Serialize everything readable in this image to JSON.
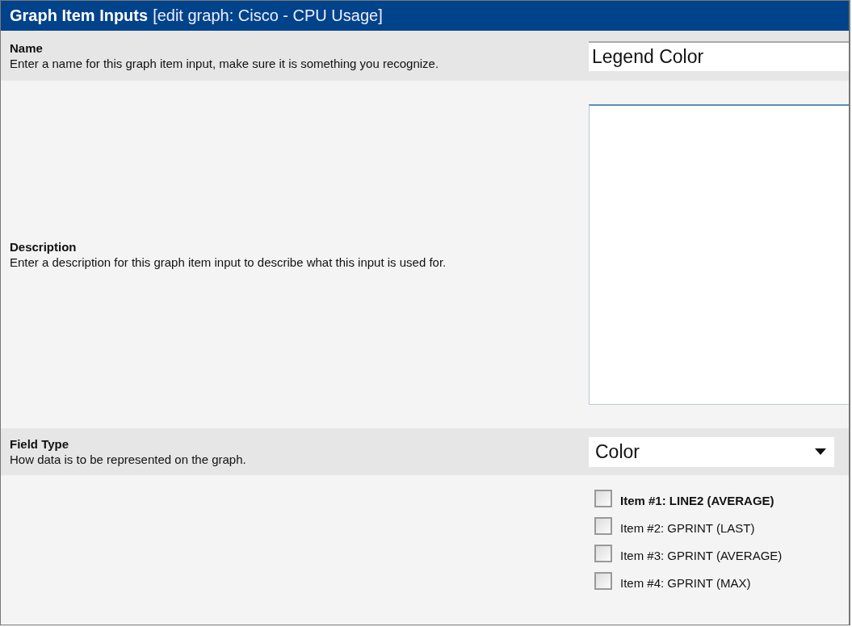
{
  "header": {
    "title": "Graph Item Inputs",
    "subtitle": "[edit graph: Cisco - CPU Usage]"
  },
  "rows": [
    {
      "kind": "text",
      "label": "Name",
      "description": "Enter a name for this graph item input, make sure it is something you recognize.",
      "value": "Legend Color"
    },
    {
      "kind": "textarea",
      "label": "Description",
      "description": "Enter a description for this graph item input to describe what this input is used for."
    },
    {
      "kind": "select",
      "label": "Field Type",
      "description": "How data is to be represented on the graph.",
      "value": "Color"
    },
    {
      "kind": "checkboxes",
      "items": [
        {
          "label": "Item #1: LINE2 (AVERAGE)",
          "checked": false,
          "emphasized": true
        },
        {
          "label": "Item #2: GPRINT (LAST)",
          "checked": false,
          "emphasized": false
        },
        {
          "label": "Item #3: GPRINT (AVERAGE)",
          "checked": false,
          "emphasized": false
        },
        {
          "label": "Item #4: GPRINT (MAX)",
          "checked": false,
          "emphasized": false
        }
      ]
    }
  ]
}
